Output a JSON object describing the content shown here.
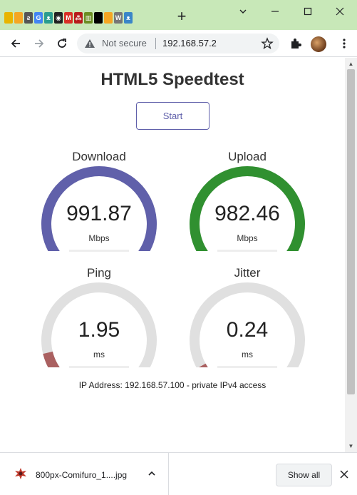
{
  "window": {
    "new_tab_symbol": "+",
    "tab_favicons": [
      {
        "name": "bookmark-favicon",
        "color": "#e8b400",
        "glyph": ""
      },
      {
        "name": "bookmark-favicon",
        "color": "#f5a623",
        "glyph": ""
      },
      {
        "name": "lemur-favicon",
        "color": "#555555",
        "glyph": "ƨ"
      },
      {
        "name": "google-favicon",
        "color": "#4285f4",
        "glyph": "G"
      },
      {
        "name": "mascot-favicon",
        "color": "#2a9d8f",
        "glyph": "ᴥ"
      },
      {
        "name": "ghost-favicon",
        "color": "#222222",
        "glyph": "◉"
      },
      {
        "name": "gmail-favicon",
        "color": "#d93025",
        "glyph": "M"
      },
      {
        "name": "mahjong-favicon",
        "color": "#b71c1c",
        "glyph": "⁂"
      },
      {
        "name": "mahjong-tile-favicon",
        "color": "#6b8e23",
        "glyph": "▥"
      },
      {
        "name": "black-tile-favicon",
        "color": "#000000",
        "glyph": ""
      },
      {
        "name": "bookmark-favicon",
        "color": "#f5a623",
        "glyph": ""
      },
      {
        "name": "wikipedia-favicon",
        "color": "#777777",
        "glyph": "W"
      },
      {
        "name": "game-favicon",
        "color": "#3a86c8",
        "glyph": "ᴥ"
      }
    ]
  },
  "omnibox": {
    "security_label": "Not secure",
    "url": "192.168.57.2"
  },
  "page": {
    "title": "HTML5 Speedtest",
    "start_label": "Start",
    "ip_info": "IP Address: 192.168.57.100 - private IPv4 access"
  },
  "meters": [
    {
      "label": "Download",
      "value": "991.87",
      "unit": "Mbps",
      "level": 1.0,
      "color": "#6060aa"
    },
    {
      "label": "Upload",
      "value": "982.46",
      "unit": "Mbps",
      "level": 1.0,
      "color": "#309030"
    },
    {
      "label": "Ping",
      "value": "1.95",
      "unit": "ms",
      "level": 0.1,
      "color": "#aa6060"
    },
    {
      "label": "Jitter",
      "value": "0.24",
      "unit": "ms",
      "level": 0.04,
      "color": "#aa6060"
    }
  ],
  "gauge_track_color": "#e0e0e0",
  "download_shelf": {
    "file_name": "800px-Comifuro_1....jpg",
    "show_all_label": "Show all"
  }
}
